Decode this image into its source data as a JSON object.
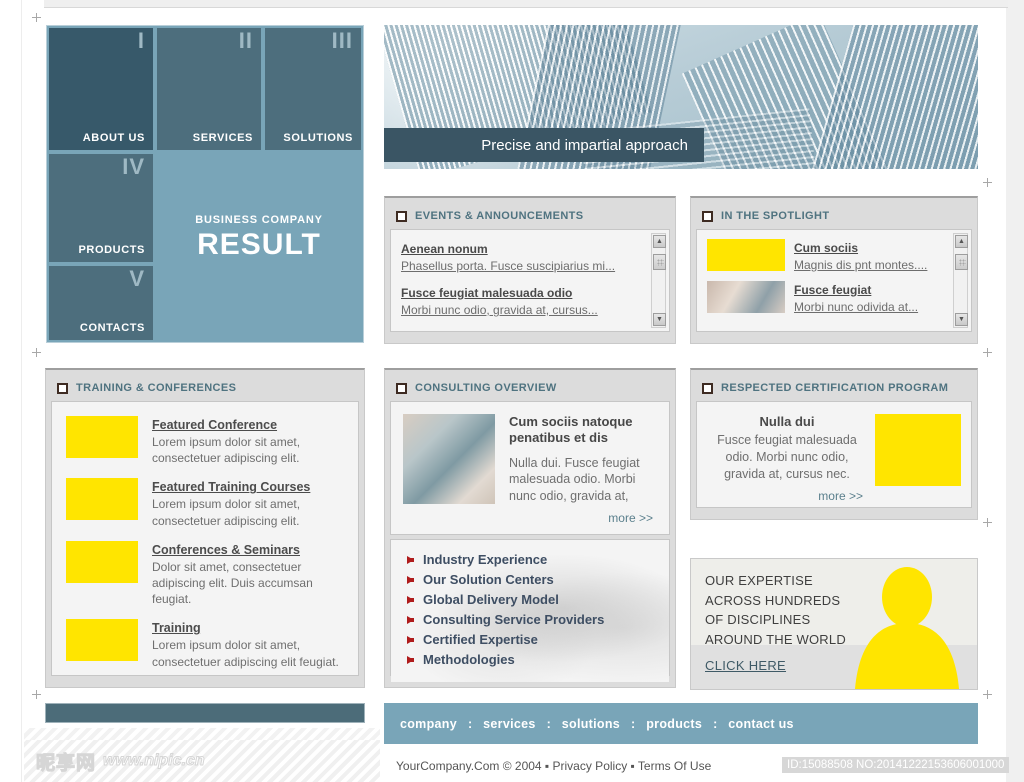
{
  "brand": {
    "supertitle": "BUSINESS COMPANY",
    "title": "RESULT"
  },
  "colors": {
    "accent_light": "#79a5b8",
    "accent_dark": "#37596a",
    "tile": "#4d6e7d",
    "highlight_yellow": "#ffe500",
    "bullet_red": "#b01c1c",
    "panel_header_text": "#4f7380"
  },
  "hero_nav": {
    "tiles": [
      {
        "numeral": "I",
        "label": "ABOUT US"
      },
      {
        "numeral": "II",
        "label": "SERVICES"
      },
      {
        "numeral": "III",
        "label": "SOLUTIONS"
      },
      {
        "numeral": "IV",
        "label": "PRODUCTS"
      },
      {
        "numeral": "V",
        "label": "CONTACTS"
      }
    ]
  },
  "hero": {
    "caption": "Precise and impartial approach",
    "image_alt": "skyscrapers-photo"
  },
  "events_panel": {
    "title": "EVENTS & ANNOUNCEMENTS",
    "items": [
      {
        "title": "Aenean nonum",
        "text": "Phasellus porta. Fusce suscipiarius mi..."
      },
      {
        "title": "Fusce feugiat malesuada odio",
        "text": "Morbi nunc odio, gravida at, cursus..."
      }
    ],
    "scroll_up": "▲",
    "scroll_down": "▼"
  },
  "spotlight_panel": {
    "title": "IN THE SPOTLIGHT",
    "items": [
      {
        "title": "Cum sociis",
        "text": "Magnis dis pnt montes....",
        "thumb": "yellow"
      },
      {
        "title": "Fusce feugiat",
        "text": "Morbi nunc odivida at...",
        "thumb": "photo"
      }
    ],
    "scroll_up": "▲",
    "scroll_down": "▼"
  },
  "training_panel": {
    "title": "TRAINING & CONFERENCES",
    "items": [
      {
        "title": "Featured Conference",
        "text": "Lorem ipsum dolor sit amet, consectetuer adipiscing elit."
      },
      {
        "title": "Featured Training Courses",
        "text": "Lorem ipsum dolor sit amet, consectetuer adipiscing elit."
      },
      {
        "title": "Conferences & Seminars",
        "text": "Dolor sit amet, consectetuer adipiscing elit. Duis accumsan feugiat."
      },
      {
        "title": "Training",
        "text": "Lorem ipsum dolor sit amet, consectetuer adipiscing elit feugiat."
      }
    ]
  },
  "consulting_panel": {
    "title": "CONSULTING OVERVIEW",
    "feature": {
      "heading": "Cum sociis natoque penatibus et dis",
      "text": "Nulla dui. Fusce feugiat malesuada odio. Morbi nunc odio, gravida at,",
      "more_label": "more >>",
      "image_alt": "hand-using-card-reader-photo"
    },
    "links": [
      "Industry Experience",
      "Our Solution Centers",
      "Global Delivery Model",
      "Consulting Service Providers",
      "Certified Expertise",
      "Methodologies"
    ]
  },
  "certification_panel": {
    "title": "RESPECTED CERTIFICATION PROGRAM",
    "heading": "Nulla dui",
    "text": "Fusce feugiat malesuada odio. Morbi nunc odio, gravida at, cursus nec.",
    "more_label": "more >>"
  },
  "promo": {
    "lines": [
      "OUR EXPERTISE",
      "ACROSS HUNDREDS",
      "OF DISCIPLINES",
      "AROUND THE WORLD"
    ],
    "cta": "CLICK HERE",
    "silhouette_alt": "person-silhouette-icon"
  },
  "footer": {
    "nav": [
      "company",
      "services",
      "solutions",
      "products",
      "contact us"
    ],
    "separator": ":",
    "copyright": "YourCompany.Com © 2004 ▪ Privacy Policy ▪ Terms Of Use",
    "id_badge": "ID:15088508 NO:20141222153606001000"
  },
  "watermark": {
    "cn": "昵享网",
    "url": "www.nipic.cn"
  }
}
